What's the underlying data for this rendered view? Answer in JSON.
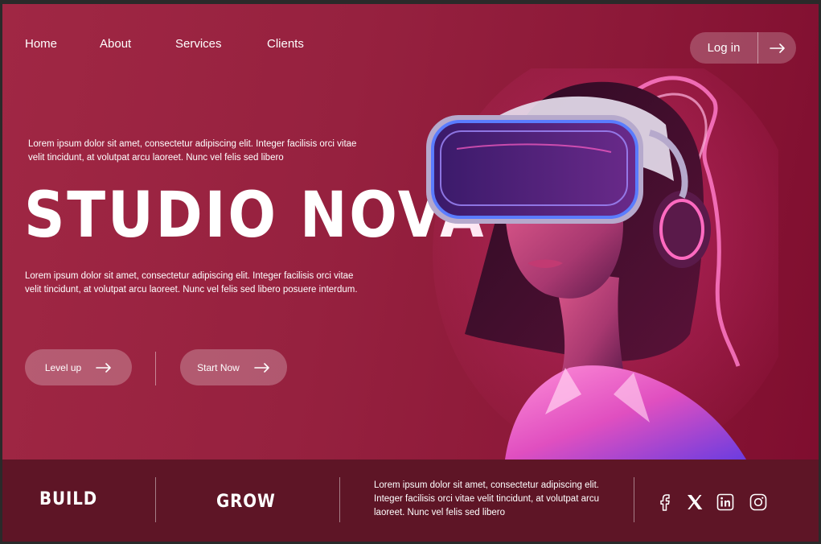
{
  "nav": {
    "items": [
      {
        "label": "Home"
      },
      {
        "label": "About"
      },
      {
        "label": "Services"
      },
      {
        "label": "Clients"
      }
    ],
    "login_label": "Log in"
  },
  "hero": {
    "intro_text": "Lorem ipsum dolor sit amet, consectetur adipiscing elit. Integer facilisis orci vitae velit tincidunt, at volutpat arcu laoreet. Nunc vel felis sed libero",
    "title": "STUDIO NOVA",
    "body_text": "Lorem ipsum dolor sit amet, consectetur adipiscing elit. Integer facilisis orci vitae velit tincidunt, at volutpat arcu laoreet. Nunc vel felis sed libero posuere interdum.",
    "buttons": [
      {
        "label": "Level up"
      },
      {
        "label": "Start Now"
      }
    ]
  },
  "footer": {
    "word1": "BUILD",
    "word2": "GROW",
    "text": "Lorem ipsum dolor sit amet, consectetur adipiscing elit. Integer facilisis orci vitae velit tincidunt, at volutpat arcu laoreet. Nunc vel felis sed libero",
    "social": [
      "facebook-icon",
      "x-icon",
      "linkedin-icon",
      "instagram-icon"
    ]
  },
  "colors": {
    "bg_left": "#a02744",
    "bg_right": "#7e0d2e",
    "footer_bg": "#5e1526",
    "neon_pink": "#ff4fb5",
    "neon_blue": "#6b5cff"
  }
}
